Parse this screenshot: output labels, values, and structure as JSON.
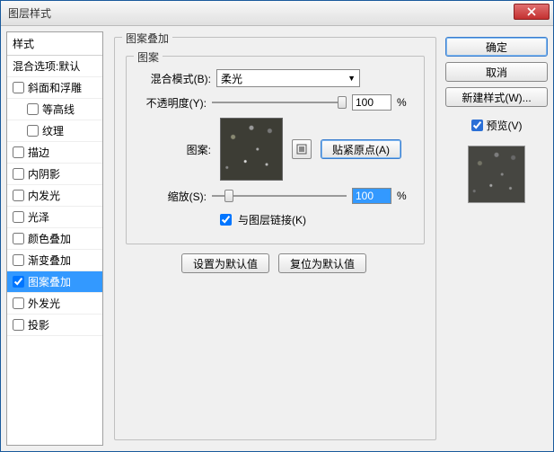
{
  "title": "图层样式",
  "styles": {
    "header": "样式",
    "blending": "混合选项:默认",
    "items": [
      {
        "label": "斜面和浮雕",
        "checked": false
      },
      {
        "label": "等高线",
        "checked": false,
        "indent": true
      },
      {
        "label": "纹理",
        "checked": false,
        "indent": true
      },
      {
        "label": "描边",
        "checked": false
      },
      {
        "label": "内阴影",
        "checked": false
      },
      {
        "label": "内发光",
        "checked": false
      },
      {
        "label": "光泽",
        "checked": false
      },
      {
        "label": "颜色叠加",
        "checked": false
      },
      {
        "label": "渐变叠加",
        "checked": false
      },
      {
        "label": "图案叠加",
        "checked": true,
        "selected": true
      },
      {
        "label": "外发光",
        "checked": false
      },
      {
        "label": "投影",
        "checked": false
      }
    ]
  },
  "center": {
    "group_title": "图案叠加",
    "pattern_group": "图案",
    "blend_mode_label": "混合模式(B):",
    "blend_mode_value": "柔光",
    "opacity_label": "不透明度(Y):",
    "opacity_value": "100",
    "percent": "%",
    "pattern_label": "图案:",
    "snap_origin": "贴紧原点(A)",
    "scale_label": "缩放(S):",
    "scale_value": "100",
    "link_with_layer": "与图层链接(K)",
    "set_default": "设置为默认值",
    "reset_default": "复位为默认值"
  },
  "right": {
    "ok": "确定",
    "cancel": "取消",
    "new_style": "新建样式(W)...",
    "preview": "预览(V)"
  }
}
